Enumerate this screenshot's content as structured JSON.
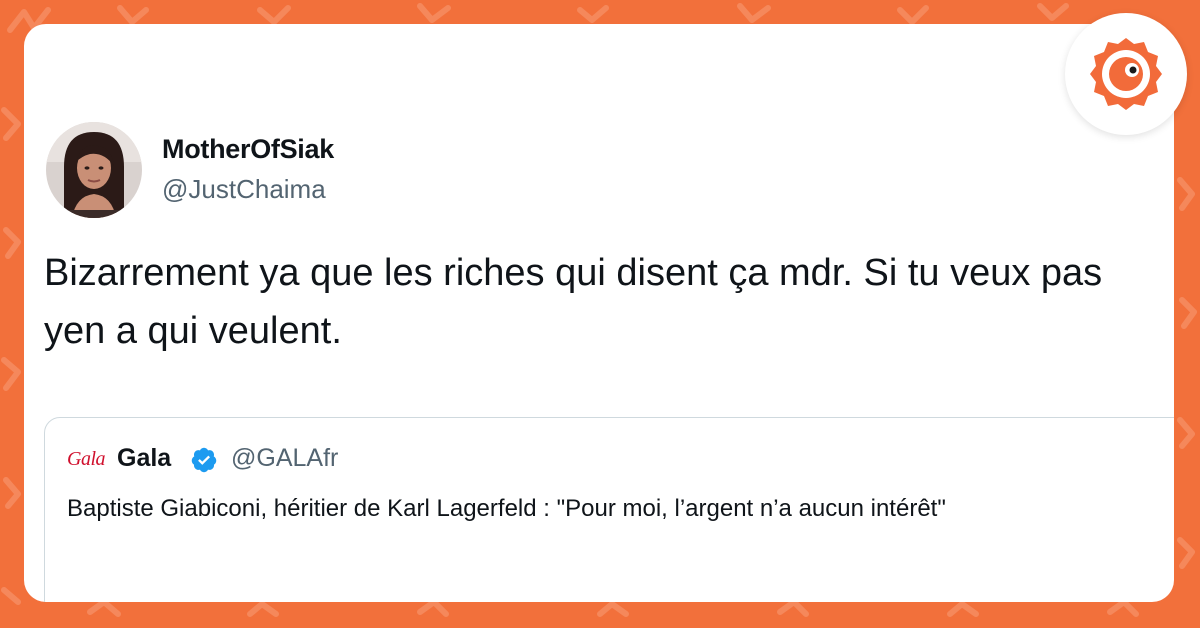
{
  "tweet": {
    "display_name": "MotherOfSiak",
    "handle": "@JustChaima",
    "text": "Bizarrement ya que les riches qui disent ça mdr. Si tu veux pas yen a qui veulent."
  },
  "quoted_tweet": {
    "logo_text": "Gala",
    "display_name": "Gala",
    "handle": "@GALAfr",
    "text": "Baptiste Giabiconi, héritier de Karl Lagerfeld : \"Pour moi, l’argent n’a aucun intérêt\""
  },
  "colors": {
    "background": "#f2703b",
    "card": "#ffffff",
    "verified": "#1d9bf0",
    "brand_accent": "#f26b3a"
  },
  "icons": {
    "verified": "verified-badge-icon",
    "brand": "brand-logo-icon"
  }
}
